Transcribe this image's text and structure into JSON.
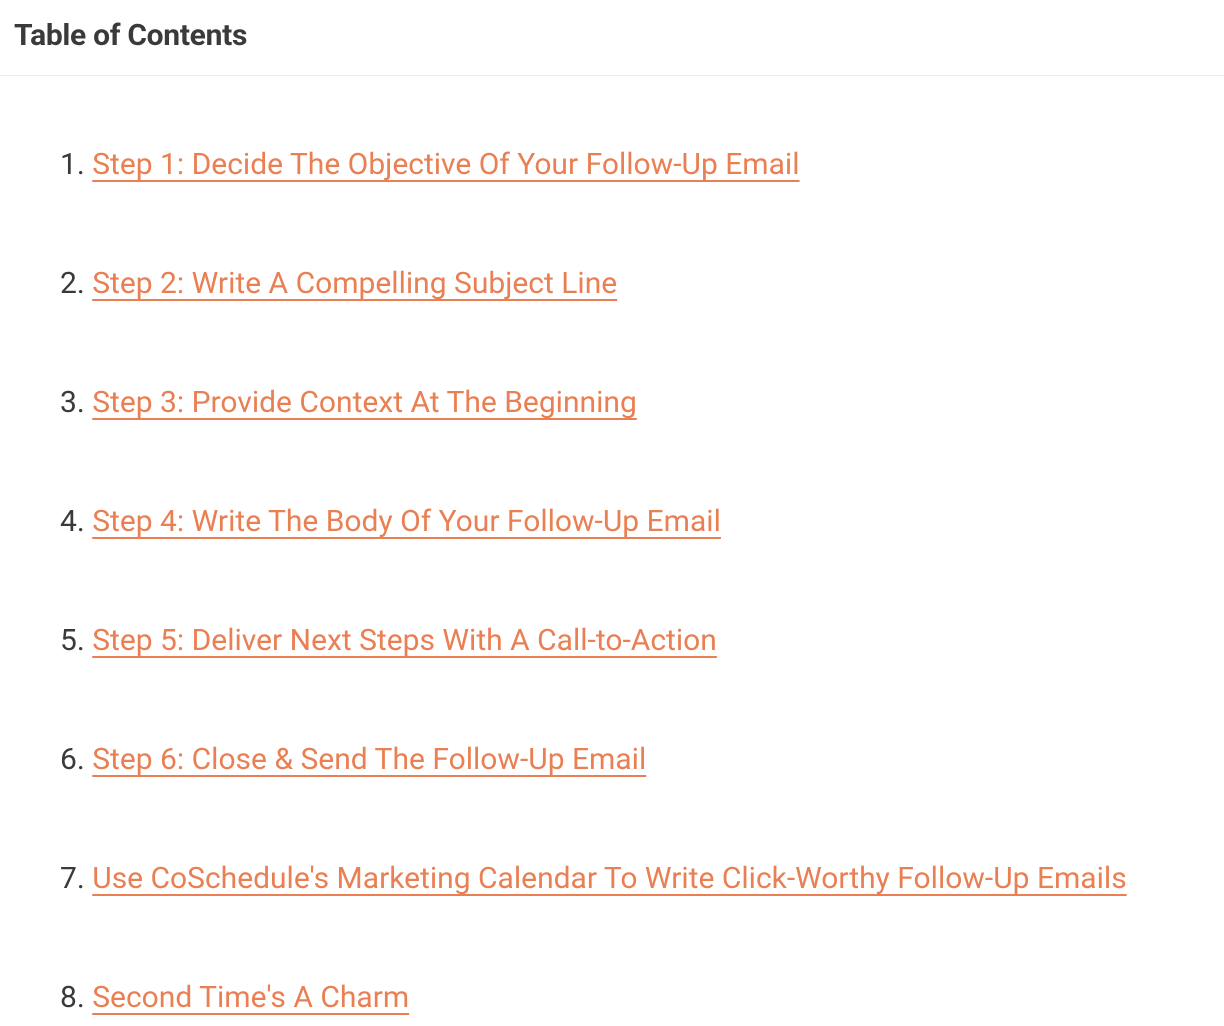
{
  "header": {
    "title": "Table of Contents"
  },
  "toc": {
    "items": [
      {
        "label": "Step 1: Decide The Objective Of Your Follow-Up Email"
      },
      {
        "label": "Step 2: Write A Compelling Subject Line"
      },
      {
        "label": "Step 3: Provide Context At The Beginning"
      },
      {
        "label": "Step 4: Write The Body Of Your Follow-Up Email"
      },
      {
        "label": "Step 5: Deliver Next Steps With A Call-to-Action"
      },
      {
        "label": "Step 6: Close & Send The Follow-Up Email"
      },
      {
        "label": "Use CoSchedule's Marketing Calendar To Write Click-Worthy Follow-Up Emails"
      },
      {
        "label": "Second Time's A Charm"
      }
    ]
  }
}
